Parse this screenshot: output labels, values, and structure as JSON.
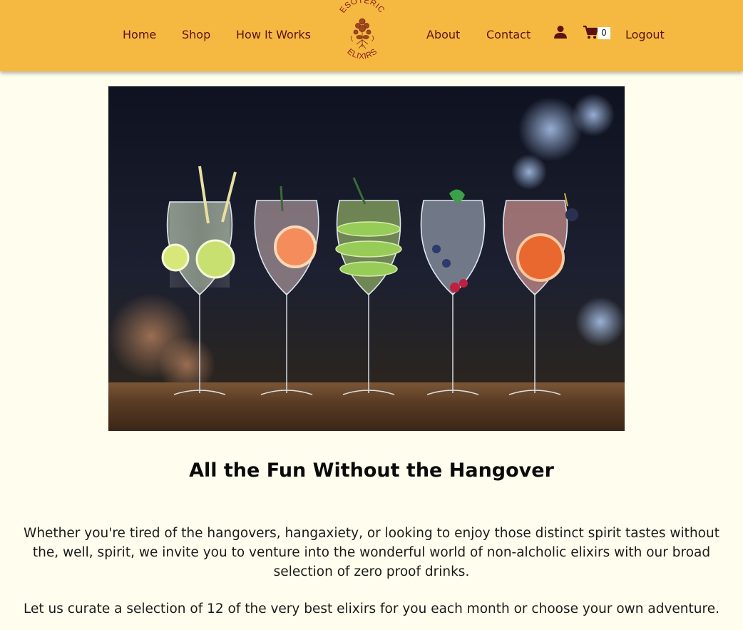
{
  "nav": {
    "left": [
      {
        "label": "Home"
      },
      {
        "label": "Shop"
      },
      {
        "label": "How It Works"
      }
    ],
    "right": [
      {
        "label": "About"
      },
      {
        "label": "Contact"
      }
    ],
    "logout_label": "Logout",
    "cart_count": "0",
    "user_icon": "user-icon",
    "cart_icon": "shopping-cart-icon"
  },
  "logo": {
    "top_text": "ESOTERIC",
    "bottom_text": "ELIXIRS"
  },
  "hero": {
    "subject": "five garnished cocktail glasses on a bar counter"
  },
  "main": {
    "headline": "All the Fun Without the Hangover",
    "intro": "Whether you're tired of the hangovers, hangaxiety, or looking to enjoy those distinct spirit tastes without the, well, spirit, we invite you to venture into the wonderful world of non-alcholic elixirs with our broad selection of zero proof drinks.",
    "offer": "Let us curate a selection of 12 of the very best elixirs for you each month or choose your own adventure."
  },
  "colors": {
    "header_bg": "#f5b942",
    "nav_text": "#5a1212",
    "page_bg": "#fffeee"
  }
}
